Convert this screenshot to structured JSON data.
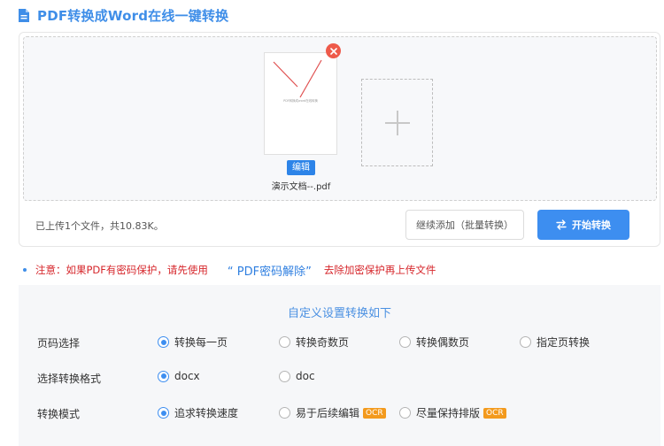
{
  "header": {
    "title": "PDF转换成Word在线一键转换",
    "icon": "document-icon"
  },
  "upload": {
    "file": {
      "name": "演示文档--.pdf",
      "thumb_caption": "PDF转换成word在线转换",
      "edit_label": "编辑"
    },
    "status_text": "已上传1个文件，共10.83K。",
    "batch_label": "继续添加（批量转换）",
    "start_label": "开始转换"
  },
  "notice": {
    "prefix": "注意：如果PDF有密码保护，请先使用",
    "link": "“ PDF密码解除”",
    "suffix": "去除加密保护再上传文件"
  },
  "settings": {
    "title": "自定义设置转换如下",
    "rows": [
      {
        "label": "页码选择",
        "options": [
          {
            "label": "转换每一页",
            "selected": true
          },
          {
            "label": "转换奇数页",
            "selected": false
          },
          {
            "label": "转换偶数页",
            "selected": false
          },
          {
            "label": "指定页转换",
            "selected": false
          }
        ]
      },
      {
        "label": "选择转换格式",
        "options": [
          {
            "label": "docx",
            "selected": true
          },
          {
            "label": "doc",
            "selected": false
          }
        ]
      },
      {
        "label": "转换模式",
        "options": [
          {
            "label": "追求转换速度",
            "selected": true
          },
          {
            "label": "易于后续编辑",
            "badge": "OCR",
            "selected": false
          },
          {
            "label": "尽量保持排版",
            "badge": "OCR",
            "selected": false
          }
        ]
      }
    ]
  },
  "colors": {
    "accent": "#3d8ef0",
    "warning": "#d6262b",
    "badge": "#f39a1d"
  }
}
